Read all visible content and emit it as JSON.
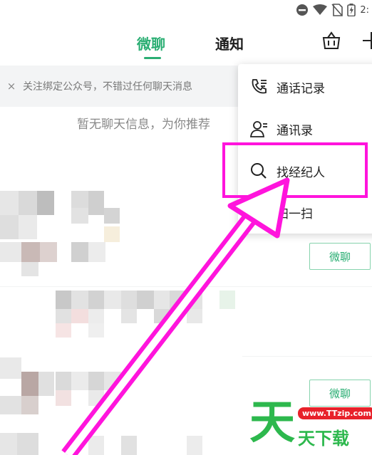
{
  "status_bar": {
    "time": "2:",
    "icons": [
      "dnd-icon",
      "wifi-icon",
      "no-sim-icon",
      "battery-icon"
    ]
  },
  "tabs": [
    {
      "label": "微聊",
      "active": true
    },
    {
      "label": "通知",
      "active": false
    }
  ],
  "header_icons": [
    "basket-icon",
    "plus-icon"
  ],
  "notice": {
    "close_label": "×",
    "text": "关注绑定公众号，不错过任何聊天消息"
  },
  "empty_text": "暂无聊天信息，为你推荐",
  "menu": {
    "items": [
      {
        "label": "通话记录",
        "icon": "call-log-icon"
      },
      {
        "label": "通讯录",
        "icon": "contacts-icon"
      },
      {
        "label": "找经纪人",
        "icon": "search-icon"
      },
      {
        "label": "扫一扫",
        "icon": "scan-icon"
      }
    ]
  },
  "recommend_buttons": [
    {
      "label": "微聊"
    },
    {
      "label": "微聊"
    }
  ],
  "watermark": {
    "big": "天",
    "url": "www.TTzip.com",
    "sub": "天下载"
  },
  "colors": {
    "accent": "#2aae73",
    "highlight": "#ff14dc",
    "watermark_green": "#2db84d",
    "watermark_red": "#e8212a"
  }
}
